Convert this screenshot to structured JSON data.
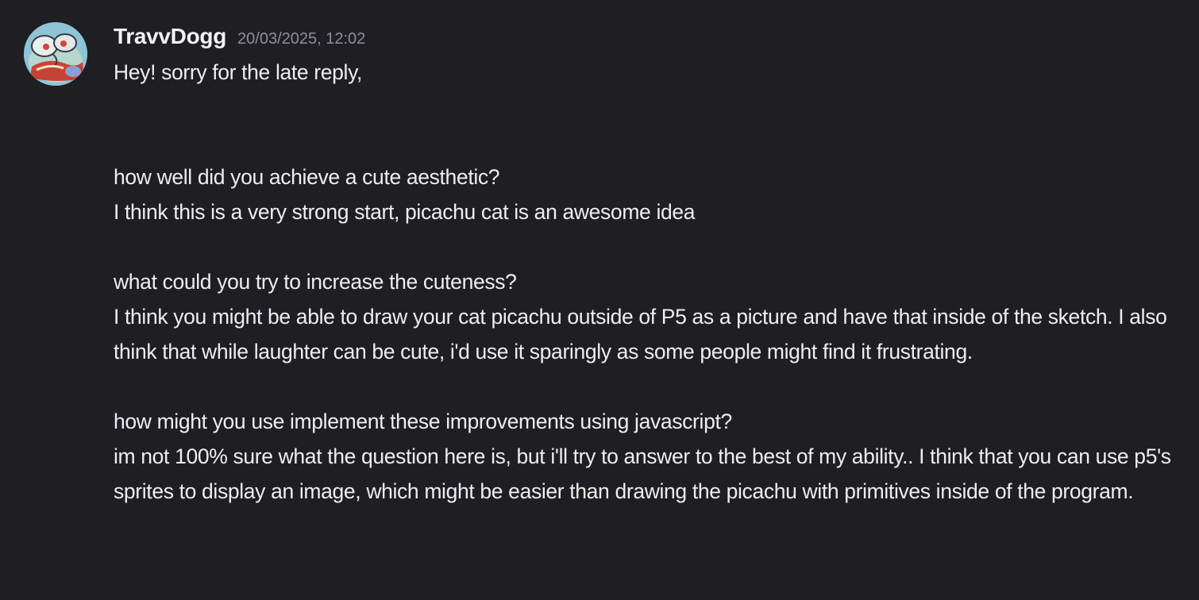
{
  "message": {
    "author": "TravvDogg",
    "timestamp": "20/03/2025, 12:02",
    "lines": [
      "Hey! sorry for the late reply,",
      "how well did you achieve a cute aesthetic?",
      "I think this is a very strong start, picachu cat is an awesome idea",
      "what could you try to increase the cuteness?",
      "I think you might be able to draw your cat picachu outside of P5 as a picture and have that inside of the sketch. I also think that while laughter can be cute, i'd use it sparingly as some people might find it frustrating.",
      "how might you use implement these improvements using javascript?",
      "im not 100% sure what the question here is, but i'll try to answer to the best of my ability.. I think that you can use p5's sprites to display an image, which might be easier than drawing the picachu with primitives inside of the program."
    ]
  },
  "avatar": {
    "icon": "user-avatar-icon",
    "bg_color": "#8fc3d6"
  },
  "colors": {
    "background": "#1e1e23",
    "text": "#eeeef2",
    "muted": "#8e9097"
  }
}
